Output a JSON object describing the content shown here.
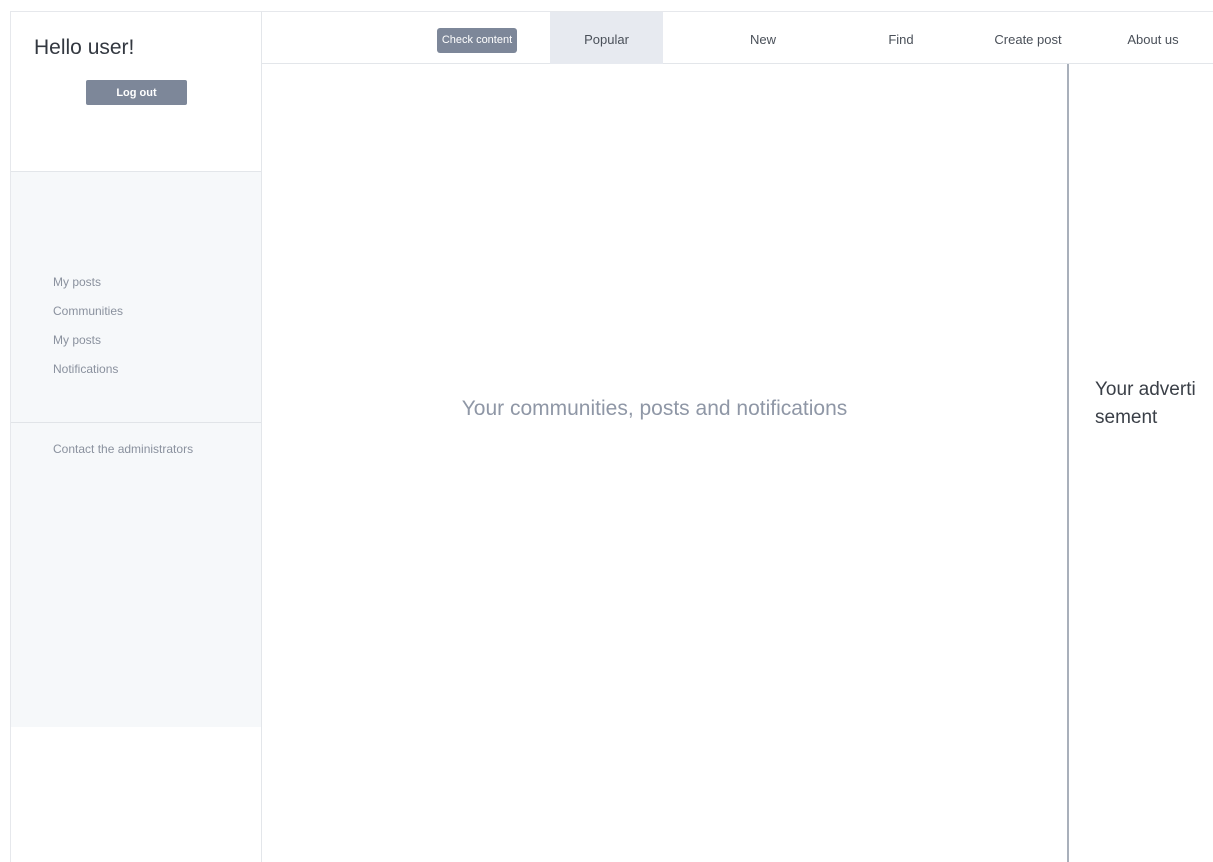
{
  "user_panel": {
    "greeting": "Hello user!",
    "logout_label": "Log out"
  },
  "sidebar": {
    "items": [
      {
        "label": "My posts"
      },
      {
        "label": "Communities"
      },
      {
        "label": "My posts"
      },
      {
        "label": "Notifications"
      }
    ],
    "contact_label": "Contact the administrators"
  },
  "topnav": {
    "check_content_label": "Check content",
    "tabs": [
      {
        "label": "Popular",
        "active": true
      },
      {
        "label": "New",
        "active": false
      },
      {
        "label": "Find",
        "active": false
      },
      {
        "label": "Create post",
        "active": false
      },
      {
        "label": "About us",
        "active": false
      }
    ]
  },
  "main": {
    "placeholder_text": "Your communities, posts and notifications"
  },
  "ad": {
    "text": "Your advertisement"
  },
  "colors": {
    "button_bg": "#7d8799",
    "active_tab_bg": "#e7eaf0",
    "sidebar_bg": "#f6f8fa",
    "muted_text": "#8f97a6"
  }
}
